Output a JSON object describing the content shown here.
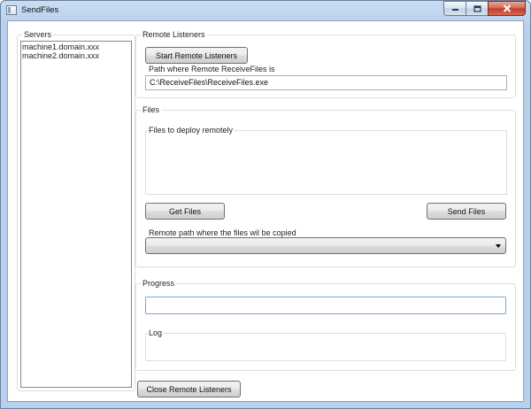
{
  "window": {
    "title": "SendFiles"
  },
  "servers": {
    "legend": "Servers",
    "items": [
      "machine1.domain.xxx",
      "machine2.domain.xxx"
    ]
  },
  "remote_listeners": {
    "legend": "Remote Listeners",
    "start_button": "Start Remote Listeners",
    "path_label": "Path where Remote ReceiveFiles is",
    "path_value": "C:\\ReceiveFiles\\ReceiveFiles.exe"
  },
  "files": {
    "legend": "Files",
    "files_box_label": "Files to deploy remotely",
    "get_files_button": "Get Files",
    "send_files_button": "Send Files",
    "remote_path_label": "Remote path where the files wil be copied",
    "remote_path_value": ""
  },
  "progress": {
    "legend": "Progress",
    "log_label": "Log"
  },
  "close_listeners_button": "Close Remote Listeners",
  "icons": {
    "app": "window-app-icon",
    "minimize": "minimize-icon",
    "maximize": "maximize-icon",
    "close": "close-icon",
    "dropdown": "chevron-down-icon"
  }
}
